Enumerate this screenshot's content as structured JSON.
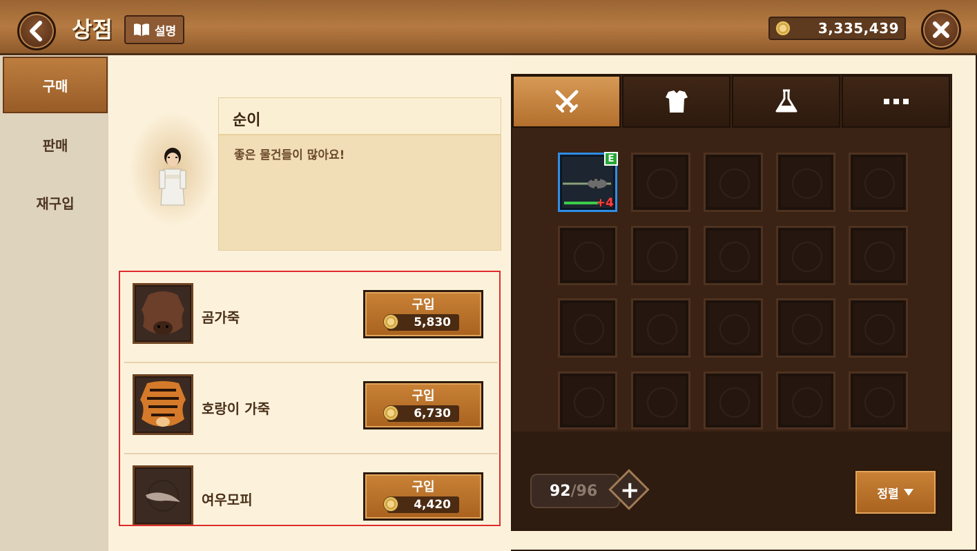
{
  "header": {
    "title": "상점",
    "help_label": "설명",
    "gold": "3,335,439"
  },
  "sidebar": {
    "tabs": [
      {
        "label": "구매",
        "active": true
      },
      {
        "label": "판매",
        "active": false
      },
      {
        "label": "재구입",
        "active": false
      }
    ]
  },
  "npc": {
    "name": "순이",
    "message": "좋은 물건들이 많아요!"
  },
  "shop": {
    "items": [
      {
        "name": "곰가죽",
        "buy_label": "구입",
        "price": "5,830"
      },
      {
        "name": "호랑이 가죽",
        "buy_label": "구입",
        "price": "6,730"
      },
      {
        "name": "여우모피",
        "buy_label": "구입",
        "price": "4,420"
      }
    ]
  },
  "inventory": {
    "categories": [
      "weapon-icon",
      "armor-icon",
      "potion-icon",
      "more-icon"
    ],
    "equipped_slot": {
      "badge": "E",
      "enhance": "+4"
    },
    "capacity_current": "92",
    "capacity_separator": "/",
    "capacity_max": "96",
    "sort_label": "정렬"
  },
  "colors": {
    "accent": "#b36f2d",
    "highlight_border": "#e02b2b",
    "equipped_border": "#2f8ee6"
  }
}
